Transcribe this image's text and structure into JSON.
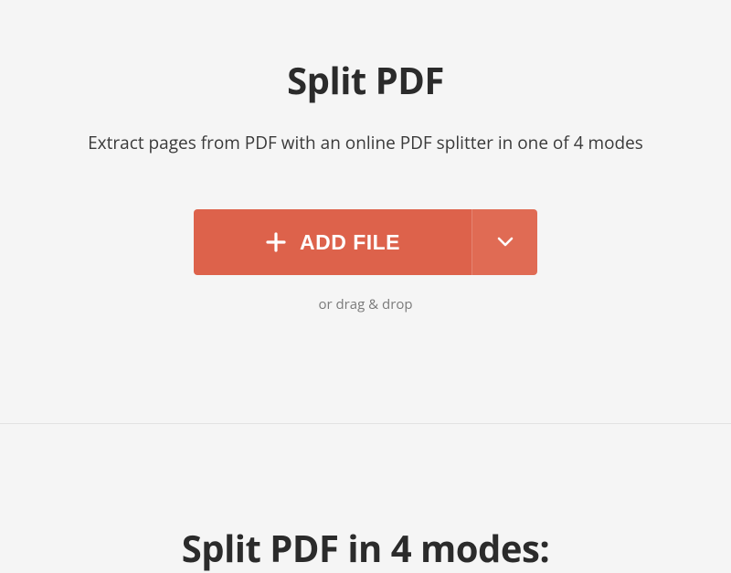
{
  "hero": {
    "title": "Split PDF",
    "subtitle": "Extract pages from PDF with an online PDF splitter in one of 4 modes",
    "add_file_label": "ADD FILE",
    "drag_hint": "or drag & drop"
  },
  "section2": {
    "title": "Split PDF in 4 modes:"
  },
  "colors": {
    "accent": "#dd624b"
  }
}
